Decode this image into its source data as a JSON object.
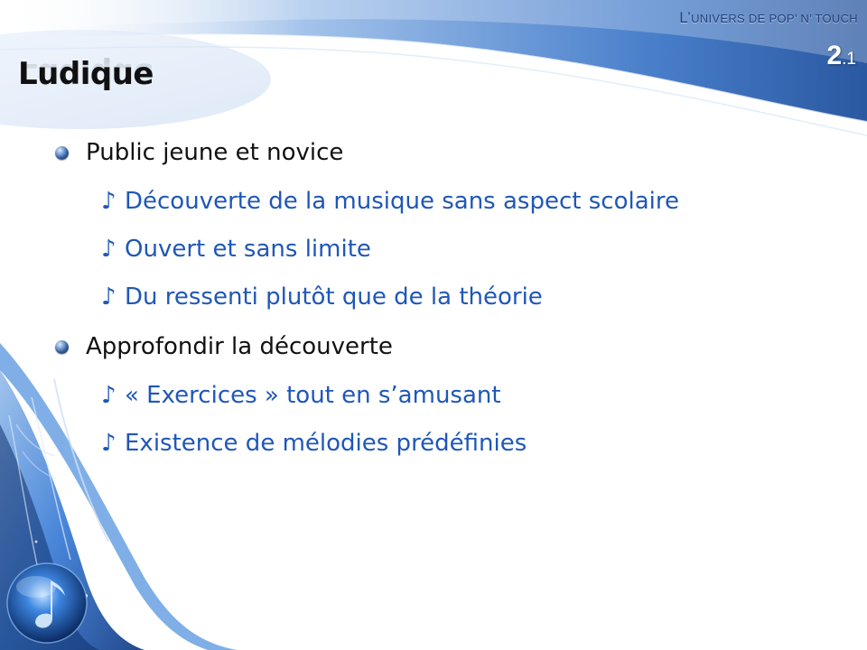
{
  "header": {
    "chapter_prefix": "L’",
    "chapter_text": "univers de Pop’ n’ Touch",
    "number_major": "2",
    "number_minor": ".1"
  },
  "title": "Ludique",
  "bullets": [
    {
      "text": "Public jeune et novice",
      "subitems": [
        "Découverte de la musique sans aspect scolaire",
        "Ouvert et sans limite",
        "Du ressenti plutôt que de la théorie"
      ]
    },
    {
      "text": "Approfondir la découverte",
      "subitems": [
        "« Exercices » tout en s’amusant",
        "Existence de mélodies prédéfinies"
      ]
    }
  ],
  "icons": {
    "level1_bullet": "blue-sphere-bullet-icon",
    "level2_bullet": "music-note-icon",
    "level2_glyph": "♪",
    "corner_decoration": "music-note-orb-icon"
  },
  "colors": {
    "header_blue": "#1f4f9c",
    "accent_blue": "#1f57b8",
    "title_text": "#111111",
    "body_text": "#111111"
  }
}
